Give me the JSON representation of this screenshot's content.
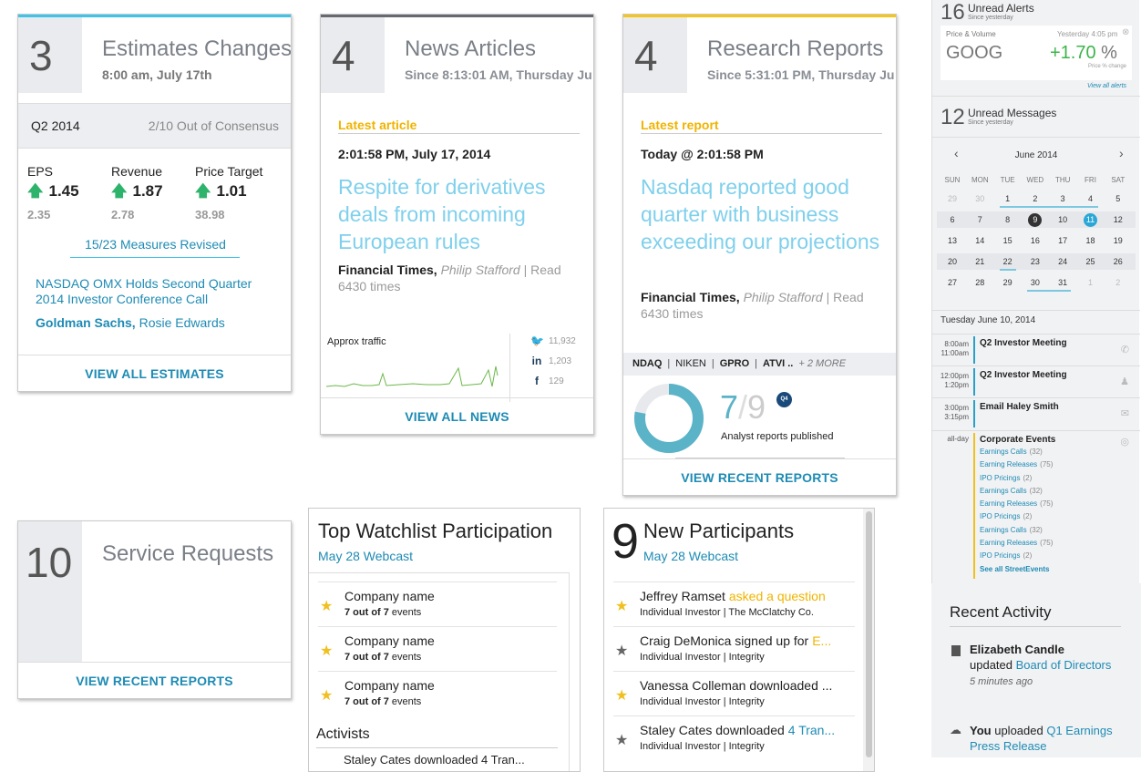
{
  "estimates": {
    "count": "3",
    "title": "Estimates Changes",
    "subtitle": "8:00 am, July 17th",
    "quarter": "Q2 2014",
    "consensus": "2/10 Out of Consensus",
    "metrics": [
      {
        "label": "EPS",
        "value": "1.45",
        "prev": "2.35"
      },
      {
        "label": "Revenue",
        "value": "1.87",
        "prev": "2.78"
      },
      {
        "label": "Price Target",
        "value": "1.01",
        "prev": "38.98"
      }
    ],
    "measures": "15/23 Measures Revised",
    "event_link": "NASDAQ OMX Holds Second Quarter 2014 Investor Conference Call",
    "firm": "Goldman Sachs,",
    "analyst": "Rosie Edwards",
    "footer": "VIEW ALL ESTIMATES",
    "accent": "#3fc4e8"
  },
  "news": {
    "count": "4",
    "title": "News Articles",
    "subtitle": "Since 8:13:01 AM, Thursday Ju",
    "section": "Latest article",
    "timestamp": "2:01:58 PM, July 17, 2014",
    "headline": "Respite for derivatives deals from incoming European rules",
    "source": "Financial Times,",
    "author": "Philip Stafford",
    "read_sep": "| Read",
    "reads": "6430 times",
    "traffic_label": "Approx traffic",
    "social": [
      {
        "icon": "twitter-icon",
        "glyph": "🐦",
        "count": "11,932"
      },
      {
        "icon": "linkedin-icon",
        "glyph": "in",
        "count": "1,203"
      },
      {
        "icon": "facebook-icon",
        "glyph": "f",
        "count": "129"
      }
    ],
    "footer": "VIEW ALL NEWS",
    "accent": "#666a70"
  },
  "research": {
    "count": "4",
    "title": "Research Reports",
    "subtitle": "Since 5:31:01 PM, Thursday Ju",
    "section": "Latest report",
    "timestamp": "Today @ 2:01:58 PM",
    "headline": "Nasdaq reported good quarter with business exceeding our projections",
    "source": "Financial Times,",
    "author": "Philip Stafford",
    "read_sep": "| Read",
    "reads": "6430 times",
    "tickers": [
      "NDAQ",
      "NIKEN",
      "GPRO",
      "ATVI"
    ],
    "tickers_more": "+ 2 MORE",
    "tickers_ellipsis": "..",
    "published": "7",
    "total": "9",
    "quarter_badge": "Q4",
    "published_label": "Analyst reports published",
    "published_fraction": 0.78,
    "footer": "VIEW RECENT REPORTS",
    "accent": "#f5c518"
  },
  "service": {
    "count": "10",
    "title": "Service Requests",
    "footer": "VIEW RECENT REPORTS"
  },
  "watchlist": {
    "title": "Top Watchlist Participation",
    "subtitle": "May 28 Webcast",
    "rows": [
      {
        "name": "Company name",
        "bold": "7 out of 7",
        "rest": "events"
      },
      {
        "name": "Company name",
        "bold": "7 out of 7",
        "rest": "events"
      },
      {
        "name": "Company name",
        "bold": "7 out of 7",
        "rest": "events"
      }
    ],
    "activists_label": "Activists",
    "activists_peek": "Staley Cates downloaded 4 Tran..."
  },
  "participants": {
    "count": "9",
    "title": "New Participants",
    "subtitle": "May 28 Webcast",
    "rows": [
      {
        "name": "Jeffrey Ramset",
        "action": "asked a question",
        "meta": "Individual Investor | The McClatchy Co.",
        "star": "gold"
      },
      {
        "name": "Craig DeMonica signed up for",
        "action": "E...",
        "meta": "Individual Investor | Integrity",
        "star": "grey"
      },
      {
        "name": "Vanessa Colleman downloaded ...",
        "action": "",
        "meta": "Individual Investor | Integrity",
        "star": "gold"
      },
      {
        "name": "Staley Cates downloaded",
        "action": "4 Tran...",
        "meta": "Individual Investor | Integrity",
        "star": "grey"
      }
    ]
  },
  "sidebar": {
    "alerts_count": "16",
    "alerts_label": "Unread Alerts",
    "alerts_since": "Since yesterday",
    "pv_label": "Price & Volume",
    "pv_time": "Yesterday 4:05 pm",
    "pv_ticker": "GOOG",
    "pv_change": "+1.70",
    "pv_unit": "%",
    "pv_caption": "Price % change",
    "view_alerts": "View all alerts",
    "messages_count": "12",
    "messages_label": "Unread Messages",
    "messages_since": "Since yesterday",
    "calendar": {
      "month": "June 2014",
      "prev": "‹",
      "next": "›",
      "days": [
        "SUN",
        "MON",
        "TUE",
        "WED",
        "THU",
        "FRI",
        "SAT"
      ],
      "weeks": [
        [
          "29",
          "30",
          "1",
          "2",
          "3",
          "4",
          "5"
        ],
        [
          "6",
          "7",
          "8",
          "9",
          "10",
          "11",
          "12"
        ],
        [
          "13",
          "14",
          "15",
          "16",
          "17",
          "18",
          "19"
        ],
        [
          "20",
          "21",
          "22",
          "23",
          "24",
          "25",
          "26"
        ],
        [
          "27",
          "28",
          "29",
          "30",
          "31",
          "1",
          "2"
        ]
      ]
    },
    "agenda_date": "Tuesday June 10, 2014",
    "events": [
      {
        "start": "8:00am",
        "end": "11:00am",
        "title": "Q2 Investor Meeting",
        "icon": "phone-icon",
        "glyph": "✆"
      },
      {
        "start": "12:00pm",
        "end": "1:20pm",
        "title": "Q2 Investor Meeting",
        "icon": "people-icon",
        "glyph": "♟"
      },
      {
        "start": "3:00pm",
        "end": "3:15pm",
        "title": "Email Haley Smith",
        "icon": "mail-icon",
        "glyph": "✉"
      }
    ],
    "allday_label": "all-day",
    "corporate_title": "Corporate Events",
    "street_events": [
      {
        "name": "Earnings Calls",
        "count": "(32)"
      },
      {
        "name": "Earning Releases",
        "count": "(75)"
      },
      {
        "name": "IPO Pricings",
        "count": "(2)"
      },
      {
        "name": "Earnings Calls",
        "count": "(32)"
      },
      {
        "name": "Earning Releases",
        "count": "(75)"
      },
      {
        "name": "IPO Pricings",
        "count": "(2)"
      },
      {
        "name": "Earnings Calls",
        "count": "(32)"
      },
      {
        "name": "Earning Releases",
        "count": "(75)"
      },
      {
        "name": "IPO Pricings",
        "count": "(2)"
      }
    ],
    "see_all": "See all StreetEvents"
  },
  "recent_activity": {
    "title": "Recent Activity",
    "items": [
      {
        "actor": "Elizabeth Candle",
        "verb": "updated",
        "object": "Board of Directors",
        "time": "5 minutes ago",
        "icon": "document-icon"
      },
      {
        "actor": "You",
        "verb": "uploaded",
        "object": "Q1 Earnings Press Release",
        "time": "",
        "icon": "cloud-upload-icon"
      }
    ]
  }
}
